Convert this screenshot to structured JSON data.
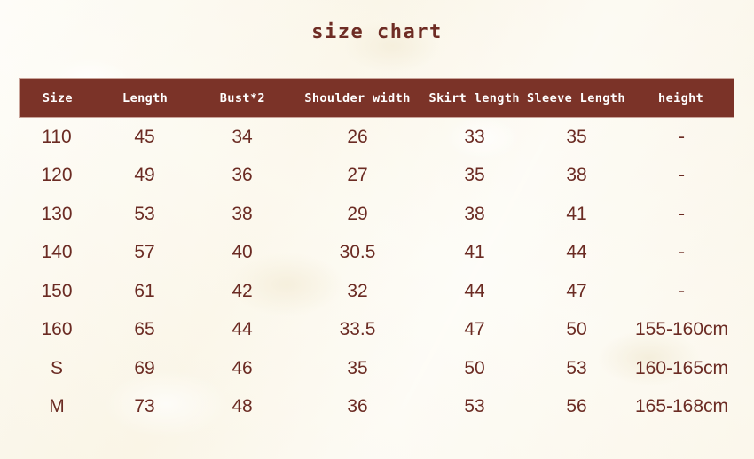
{
  "title": "size chart",
  "colors": {
    "page_background": "#fbf7e9",
    "header_background": "#7b3328",
    "header_text": "#ffffff",
    "data_text": "#6b2b23",
    "title_text": "#6e2c24",
    "header_border": "#c9a49a"
  },
  "table": {
    "columns": [
      "Size",
      "Length",
      "Bust*2",
      "Shoulder width",
      "Skirt length",
      "Sleeve Length",
      "height"
    ],
    "rows": [
      [
        "110",
        "45",
        "34",
        "26",
        "33",
        "35",
        "-"
      ],
      [
        "120",
        "49",
        "36",
        "27",
        "35",
        "38",
        "-"
      ],
      [
        "130",
        "53",
        "38",
        "29",
        "38",
        "41",
        "-"
      ],
      [
        "140",
        "57",
        "40",
        "30.5",
        "41",
        "44",
        "-"
      ],
      [
        "150",
        "61",
        "42",
        "32",
        "44",
        "47",
        "-"
      ],
      [
        "160",
        "65",
        "44",
        "33.5",
        "47",
        "50",
        "155-160cm"
      ],
      [
        "S",
        "69",
        "46",
        "35",
        "50",
        "53",
        "160-165cm"
      ],
      [
        "M",
        "73",
        "48",
        "36",
        "53",
        "56",
        "165-168cm"
      ]
    ]
  }
}
